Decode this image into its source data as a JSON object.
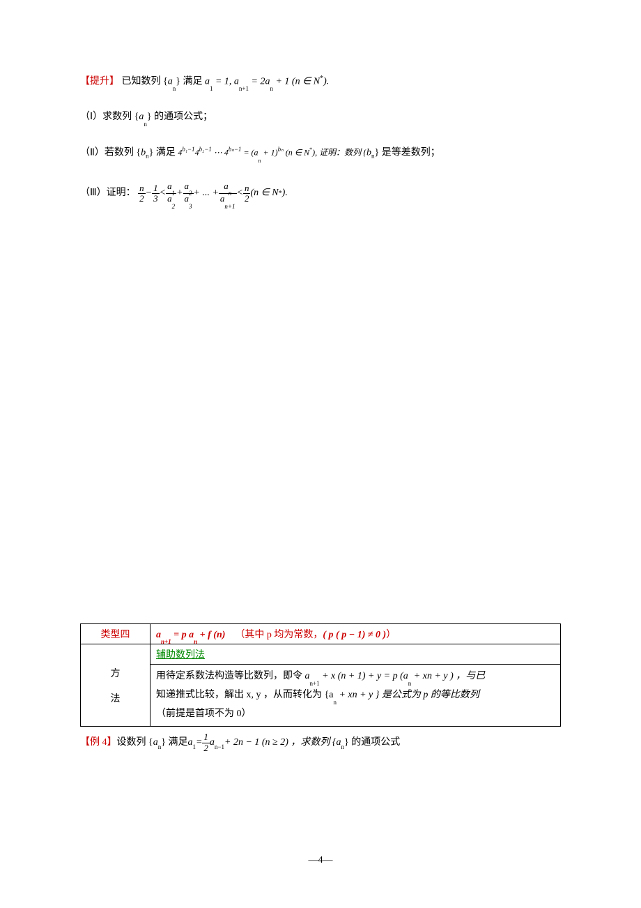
{
  "problem1": {
    "intro_label": "【提升】",
    "intro_text": "已知数列 {",
    "intro_var": "a",
    "intro_sub": "n",
    "intro_text2": "} 满足",
    "cond1": "a",
    "cond1_sub": "1",
    "cond1_eq": " = 1, ",
    "cond2": "a",
    "cond2_sub": "n+1",
    "cond2_eq": " = 2",
    "cond3": "a",
    "cond3_sub": "n",
    "cond3_tail": " + 1 (n ∈ N",
    "cond3_sup": "*",
    "cond3_end": ").",
    "part1_label": "（Ⅰ）求数列 {",
    "part1_var": "a",
    "part1_sub": "n",
    "part1_text": "} 的通项公式；",
    "part2_label": "（Ⅱ）若数列 {",
    "part2_var": "b",
    "part2_sub": "n",
    "part2_text": "} 满足",
    "part2_expr_a": "4",
    "part2_exp1": "b₁−1",
    "part2_expr_b": "4",
    "part2_exp2": "b₂−1",
    "part2_dots": " ⋯ ",
    "part2_expr_c": "4",
    "part2_exp3": "bₙ−1",
    "part2_eq": " = (a",
    "part2_eq_sub": "n",
    "part2_eq2": " + 1)",
    "part2_exp4": "bₙ",
    "part2_eq3": " (n ∈ N",
    "part2_sup": "*",
    "part2_eq4": "), 证明：数列 {",
    "part2_var2": "b",
    "part2_sub2": "n",
    "part2_tail": "} 是等差数列；",
    "part3_label": "（Ⅲ）证明：",
    "p3_n": "n",
    "p3_2": "2",
    "p3_minus": " − ",
    "p3_1": "1",
    "p3_3": "3",
    "p3_lt1": " < ",
    "p3_a1": "a",
    "p3_s1n": "1",
    "p3_a2": "a",
    "p3_s2n": "2",
    "p3_plus": " + ",
    "p3_a3": "a",
    "p3_s3n": "2",
    "p3_a4": "a",
    "p3_s4n": "3",
    "p3_dots": " + ... + ",
    "p3_a5": "a",
    "p3_s5n": "n",
    "p3_a6": "a",
    "p3_s6n": "n+1",
    "p3_lt2": " < ",
    "p3_n2": "n",
    "p3_22": "2",
    "p3_tail": " (n ∈ N",
    "p3_sup": "*",
    "p3_end": ")."
  },
  "table": {
    "type_label": "类型四",
    "formula_a": "a",
    "formula_sub1": "n+1",
    "formula_eq": " = p a",
    "formula_sub2": "n",
    "formula_plus": " + f (n)",
    "formula_note": "（其中 p 均为常数，",
    "formula_cond": "( p ( p − 1) ≠ 0 )",
    "formula_end": "）",
    "method_label": "方\n\n法",
    "method_title": "辅助数列法",
    "method_body1": "用待定系数法构造等比数列，即令 ",
    "mb_a1": "a",
    "mb_s1": "n+1",
    "mb_t1": " + x (n + 1) + y = p (a",
    "mb_s2": "n",
    "mb_t2": " + xn + y ) ，与已",
    "method_body2": "知递推式比较，解出 x, y ，从而转化为 {a",
    "mb2_s1": "n",
    "mb2_t1": " + xn + y } 是公式为 p 的等比数列",
    "method_body3": "（前提是首项不为 0）"
  },
  "example4": {
    "label": "【例 4】",
    "text1": "设数列 {",
    "var1": "a",
    "sub1": "n",
    "text2": "} 满足",
    "a1": "a",
    "a1_sub": "1",
    "eq1": " = ",
    "frac_num": "1",
    "frac_den": "2",
    "a2": "a",
    "a2_sub": "n−1",
    "tail1": " + 2n − 1 (n ≥ 2) ，求数列 {",
    "var2": "a",
    "sub2": "n",
    "tail2": "} 的通项公式"
  },
  "pagenum": "—4—"
}
